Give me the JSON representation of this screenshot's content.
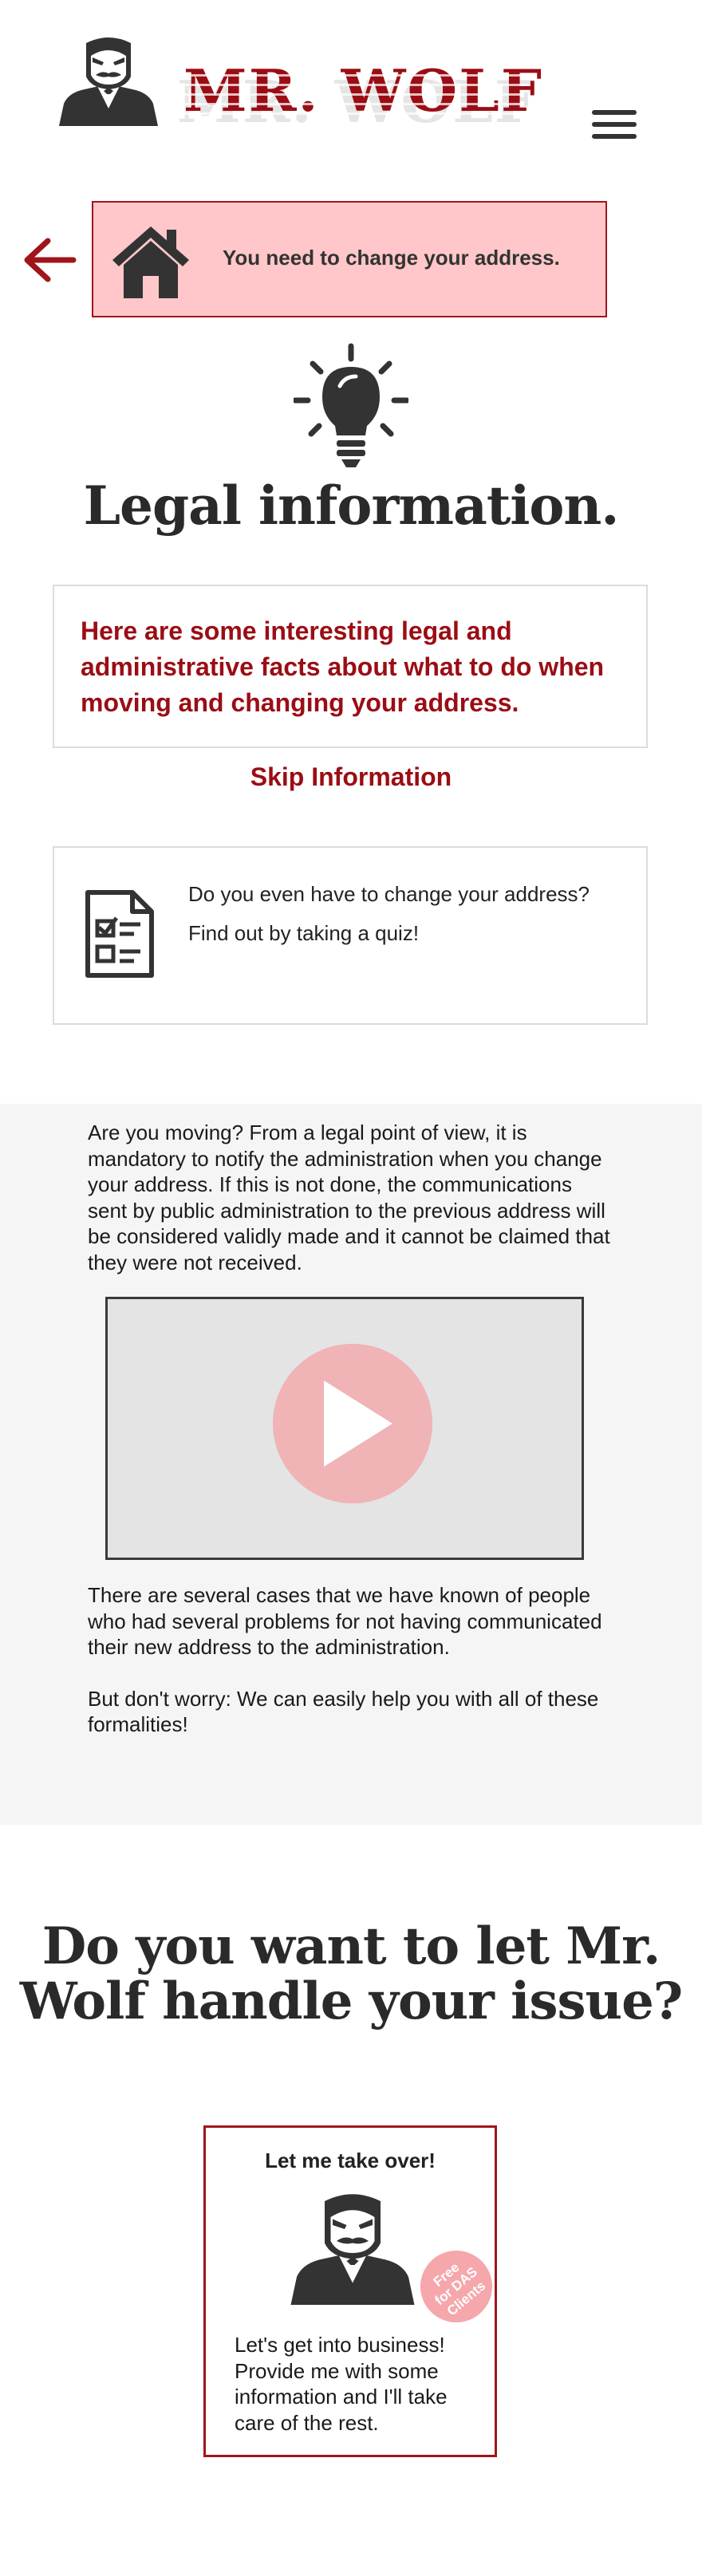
{
  "header": {
    "logo_text": "MR. WOLF",
    "logo_icon": "mr-wolf-mascot",
    "menu_icon": "hamburger-menu-icon"
  },
  "notice": {
    "back_icon": "arrow-left-icon",
    "house_icon": "house-icon",
    "text": "You need to change your address."
  },
  "legal": {
    "icon": "lightbulb-icon",
    "title": "Legal information.",
    "intro": "Here are some interesting legal and administrative facts about what to do when moving and changing your address.",
    "skip_label": "Skip Information",
    "quiz": {
      "icon": "checklist-document-icon",
      "line1": "Do you even have to change your address?",
      "line2": "Find out by taking a quiz!"
    }
  },
  "article": {
    "paragraph1": "Are you moving? From a legal point of view, it is mandatory to notify the administration when you change your address. If this is not done, the communications sent by public administration to the previous address will be considered validly made and it cannot be claimed that they were not received.",
    "video_icon": "play-icon",
    "paragraph2": "There are several cases that we have known of people who had several problems for not having communicated their new address to the administration.",
    "paragraph3": "But don't worry: We can easily help you with all of these formalities!"
  },
  "cta": {
    "title": "Do you want to let Mr. Wolf handle your issue?",
    "card_title": "Let me take over!",
    "badge": [
      "Free",
      "for DAS",
      "Clients"
    ],
    "card_text": "Let's get into business! Provide me with some information and I'll take care of the rest."
  },
  "colors": {
    "brand_red": "#9b0d14",
    "notice_pink": "#ffc7c9",
    "badge_pink": "#f5a7ab",
    "dark": "#2a2a2a"
  }
}
